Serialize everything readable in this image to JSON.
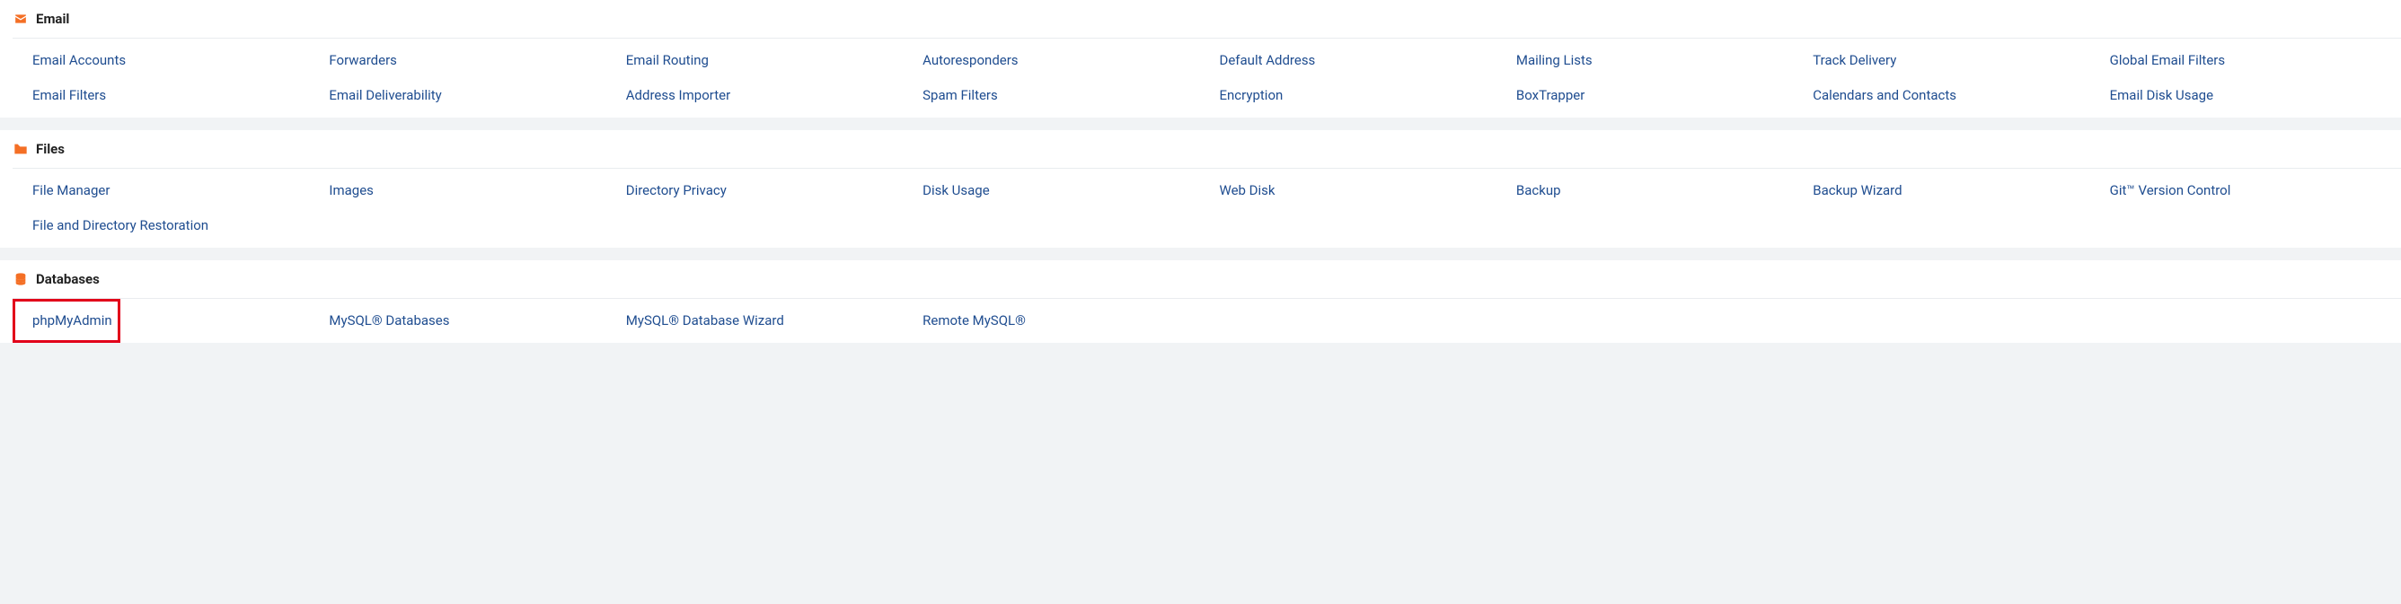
{
  "sections": [
    {
      "id": "email",
      "title": "Email",
      "icon": "envelope-icon",
      "items": [
        "Email Accounts",
        "Forwarders",
        "Email Routing",
        "Autoresponders",
        "Default Address",
        "Mailing Lists",
        "Track Delivery",
        "Global Email Filters",
        "Email Filters",
        "Email Deliverability",
        "Address Importer",
        "Spam Filters",
        "Encryption",
        "BoxTrapper",
        "Calendars and Contacts",
        "Email Disk Usage"
      ]
    },
    {
      "id": "files",
      "title": "Files",
      "icon": "folder-icon",
      "items": [
        "File Manager",
        "Images",
        "Directory Privacy",
        "Disk Usage",
        "Web Disk",
        "Backup",
        "Backup Wizard",
        "Git™ Version Control",
        "File and Directory Restoration"
      ]
    },
    {
      "id": "databases",
      "title": "Databases",
      "icon": "database-icon",
      "items": [
        "phpMyAdmin",
        "MySQL® Databases",
        "MySQL® Database Wizard",
        "Remote MySQL®"
      ],
      "highlighted_item_index": 0
    }
  ],
  "colors": {
    "accent": "#f46f25",
    "link": "#1f4d90",
    "highlight_border": "#e2001a",
    "background": "#f1f3f5",
    "panel_bg": "#ffffff"
  }
}
